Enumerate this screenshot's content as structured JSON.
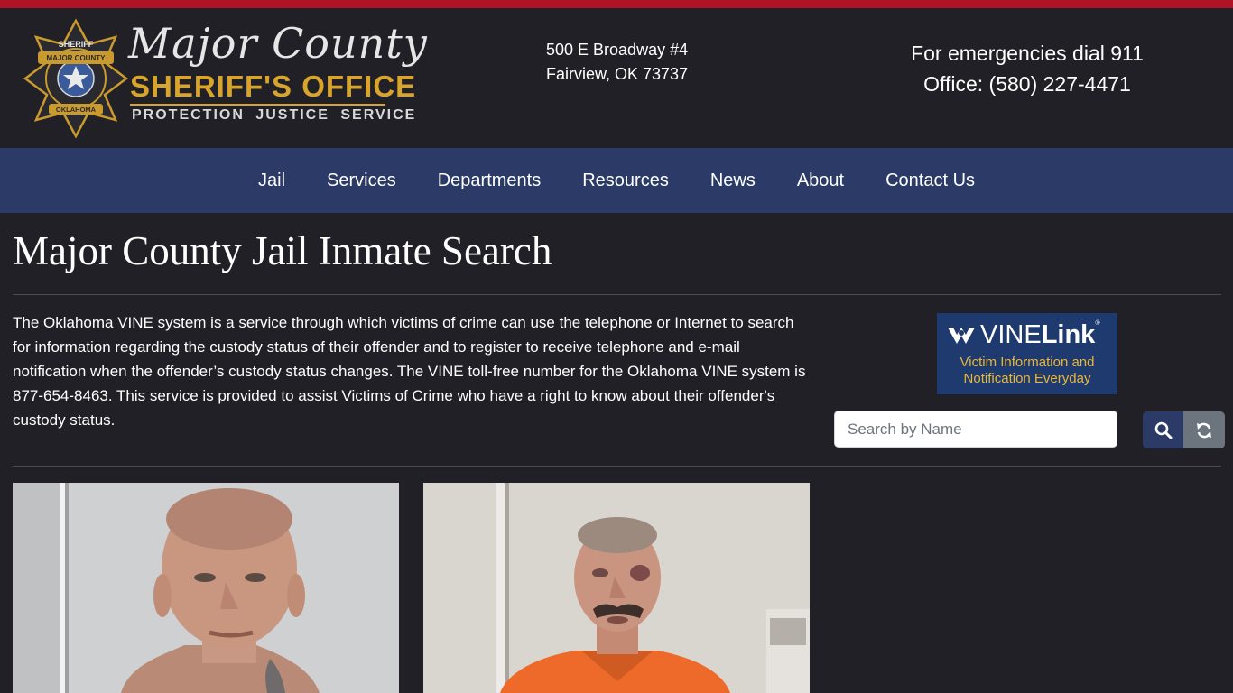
{
  "brand": {
    "script_name": "Major County",
    "office_name": "SHERIFF'S OFFICE",
    "tagline": "PROTECTION   JUSTICE   SERVICE",
    "badge_top_text": "SHERIFF",
    "badge_mid_text": "MAJOR COUNTY",
    "badge_bottom_text": "OKLAHOMA",
    "accent_color": "#b01325",
    "gold_color": "#d9a42b"
  },
  "address": {
    "line1": "500 E Broadway #4",
    "line2": "Fairview, OK 73737"
  },
  "contact": {
    "emergency": "For emergencies dial 911",
    "office": "Office: (580) 227-4471"
  },
  "nav": {
    "items": [
      {
        "label": "Jail"
      },
      {
        "label": "Services"
      },
      {
        "label": "Departments"
      },
      {
        "label": "Resources"
      },
      {
        "label": "News"
      },
      {
        "label": "About"
      },
      {
        "label": "Contact Us"
      }
    ],
    "background_color": "#2b3a66"
  },
  "page": {
    "title": "Major County Jail Inmate Search",
    "intro": "The Oklahoma VINE system is a service through which victims of crime can use the telephone or Internet to search for information regarding the custody status of their offender and to register to receive telephone and e-mail notification when the offender’s custody status changes. The VINE toll-free number for the Oklahoma VINE system is 877-654-8463. This service is provided to assist Victims of Crime who have a right to know about their offender's custody status."
  },
  "vine": {
    "brand_vine": "VINE",
    "brand_link": "Link",
    "reg_mark": "®",
    "subtitle_line1": "Victim Information and",
    "subtitle_line2": "Notification Everyday"
  },
  "search": {
    "placeholder": "Search by Name",
    "value": "",
    "search_icon": "search-icon",
    "reset_icon": "refresh-icon"
  },
  "inmates": [
    {
      "photo": "inmate-photo"
    },
    {
      "photo": "inmate-photo"
    }
  ]
}
